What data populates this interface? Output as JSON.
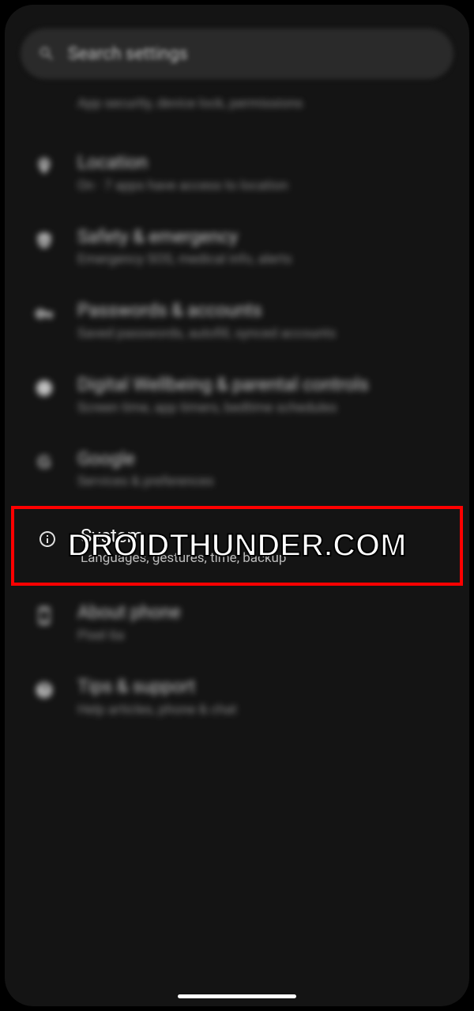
{
  "search": {
    "placeholder": "Search settings"
  },
  "partial_top": {
    "subtitle": "App security, device lock, permissions"
  },
  "items": [
    {
      "icon": "location-icon",
      "title": "Location",
      "subtitle": "On · 7 apps have access to location"
    },
    {
      "icon": "medical-icon",
      "title": "Safety & emergency",
      "subtitle": "Emergency SOS, medical info, alerts"
    },
    {
      "icon": "key-icon",
      "title": "Passwords & accounts",
      "subtitle": "Saved passwords, autofill, synced accounts"
    },
    {
      "icon": "wellbeing-icon",
      "title": "Digital Wellbeing & parental controls",
      "subtitle": "Screen time, app timers, bedtime schedules"
    },
    {
      "icon": "google-icon",
      "title": "Google",
      "subtitle": "Services & preferences"
    },
    {
      "icon": "info-icon",
      "title": "System",
      "subtitle": "Languages, gestures, time, backup",
      "highlighted": true
    },
    {
      "icon": "phone-icon",
      "title": "About phone",
      "subtitle": "Pixel 6a"
    },
    {
      "icon": "help-icon",
      "title": "Tips & support",
      "subtitle": "Help articles, phone & chat"
    }
  ],
  "watermark": "DROIDTHUNDER.COM"
}
